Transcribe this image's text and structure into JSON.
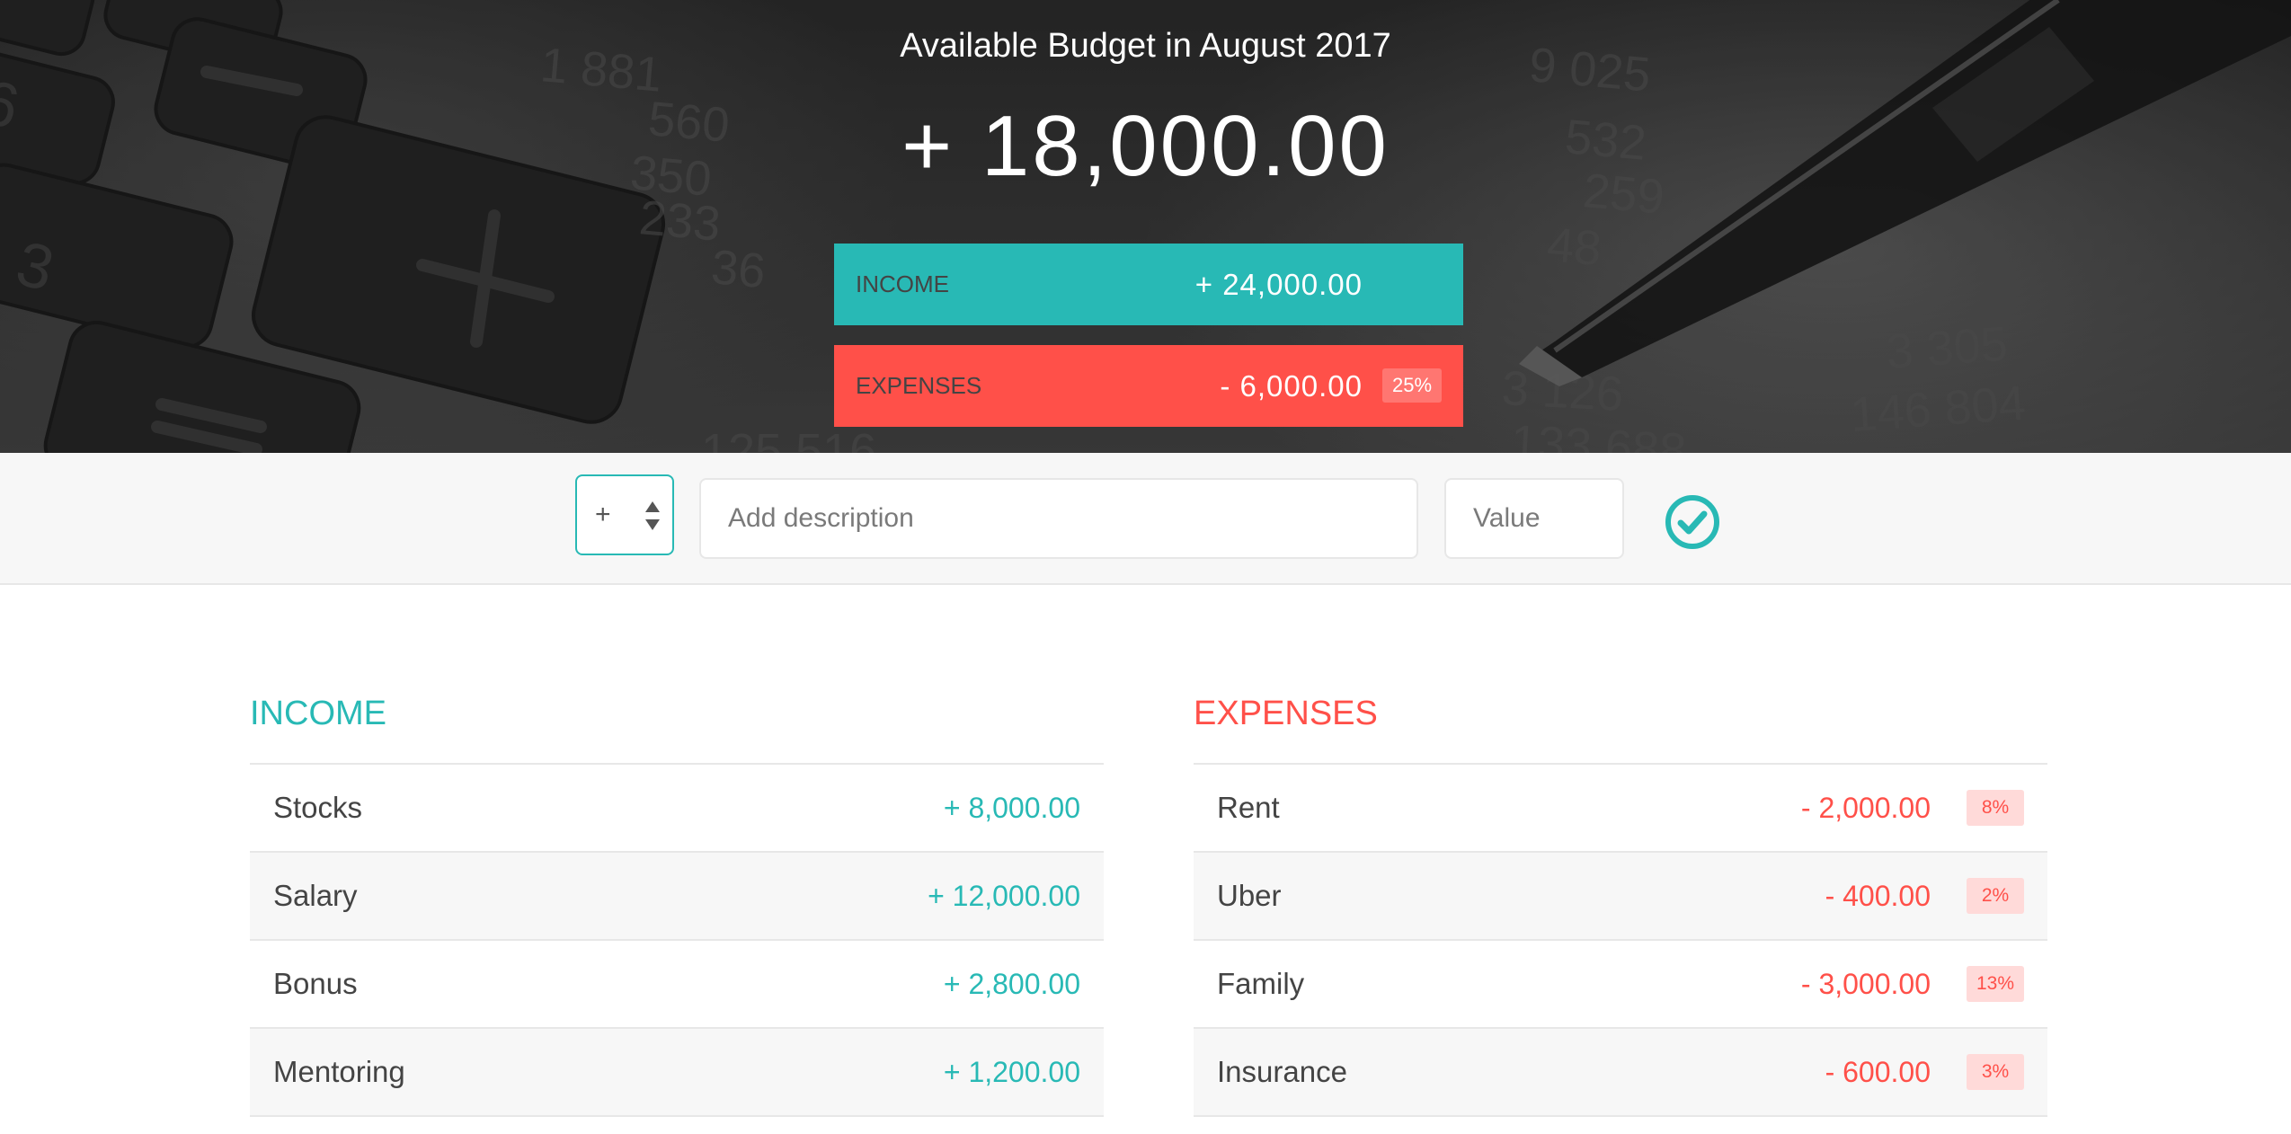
{
  "header": {
    "title": "Available Budget in August 2017",
    "budget": "+ 18,000.00",
    "income": {
      "label": "INCOME",
      "amount": "+ 24,000.00"
    },
    "expenses": {
      "label": "EXPENSES",
      "amount": "- 6,000.00",
      "percentage": "25%"
    }
  },
  "add_form": {
    "type_selected": "+",
    "description_placeholder": "Add description",
    "value_placeholder": "Value"
  },
  "income": {
    "title": "INCOME",
    "items": [
      {
        "description": "Stocks",
        "value": "+ 8,000.00"
      },
      {
        "description": "Salary",
        "value": "+ 12,000.00"
      },
      {
        "description": "Bonus",
        "value": "+ 2,800.00"
      },
      {
        "description": "Mentoring",
        "value": "+ 1,200.00"
      }
    ]
  },
  "expenses": {
    "title": "EXPENSES",
    "items": [
      {
        "description": "Rent",
        "value": "- 2,000.00",
        "percentage": "8%"
      },
      {
        "description": "Uber",
        "value": "- 400.00",
        "percentage": "2%"
      },
      {
        "description": "Family",
        "value": "- 3,000.00",
        "percentage": "13%"
      },
      {
        "description": "Insurance",
        "value": "- 600.00",
        "percentage": "3%"
      }
    ]
  },
  "colors": {
    "income": "#28b9b5",
    "expenses": "#ff5049",
    "header_bg": "#333333"
  },
  "icons": {
    "add_button": "checkmark-circle-icon",
    "type_select": "up-down-arrows-icon"
  }
}
